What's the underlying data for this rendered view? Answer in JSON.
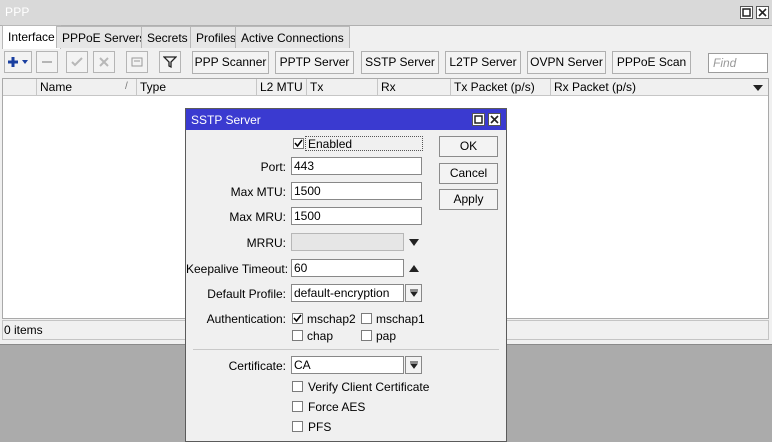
{
  "window": {
    "title": "PPP"
  },
  "tabs": [
    "Interface",
    "PPPoE Servers",
    "Secrets",
    "Profiles",
    "Active Connections"
  ],
  "toolbar": {
    "buttons": [
      "PPP Scanner",
      "PPTP Server",
      "SSTP Server",
      "L2TP Server",
      "OVPN Server",
      "PPPoE Scan"
    ],
    "find_placeholder": "Find"
  },
  "table": {
    "columns": [
      "Name",
      "Type",
      "L2 MTU",
      "Tx",
      "Rx",
      "Tx Packet (p/s)",
      "Rx Packet (p/s)"
    ],
    "status": "0 items"
  },
  "dialog": {
    "title": "SSTP Server",
    "enabled_label": "Enabled",
    "enabled": true,
    "fields": {
      "port": {
        "label": "Port:",
        "value": "443"
      },
      "max_mtu": {
        "label": "Max MTU:",
        "value": "1500"
      },
      "max_mru": {
        "label": "Max MRU:",
        "value": "1500"
      },
      "mrru": {
        "label": "MRRU:",
        "value": ""
      },
      "keepalive": {
        "label": "Keepalive Timeout:",
        "value": "60"
      },
      "default_profile": {
        "label": "Default Profile:",
        "value": "default-encryption"
      },
      "authentication_label": "Authentication:",
      "certificate": {
        "label": "Certificate:",
        "value": "CA"
      }
    },
    "auth": [
      {
        "name": "mschap2",
        "checked": true
      },
      {
        "name": "mschap1",
        "checked": false
      },
      {
        "name": "chap",
        "checked": false
      },
      {
        "name": "pap",
        "checked": false
      }
    ],
    "options": [
      {
        "label": "Verify Client Certificate",
        "checked": false
      },
      {
        "label": "Force AES",
        "checked": false
      },
      {
        "label": "PFS",
        "checked": false
      }
    ],
    "buttons": {
      "ok": "OK",
      "cancel": "Cancel",
      "apply": "Apply"
    }
  },
  "colors": {
    "dialog_title_bg": "#3a3ad0",
    "add_icon": "#1a3fa0"
  }
}
